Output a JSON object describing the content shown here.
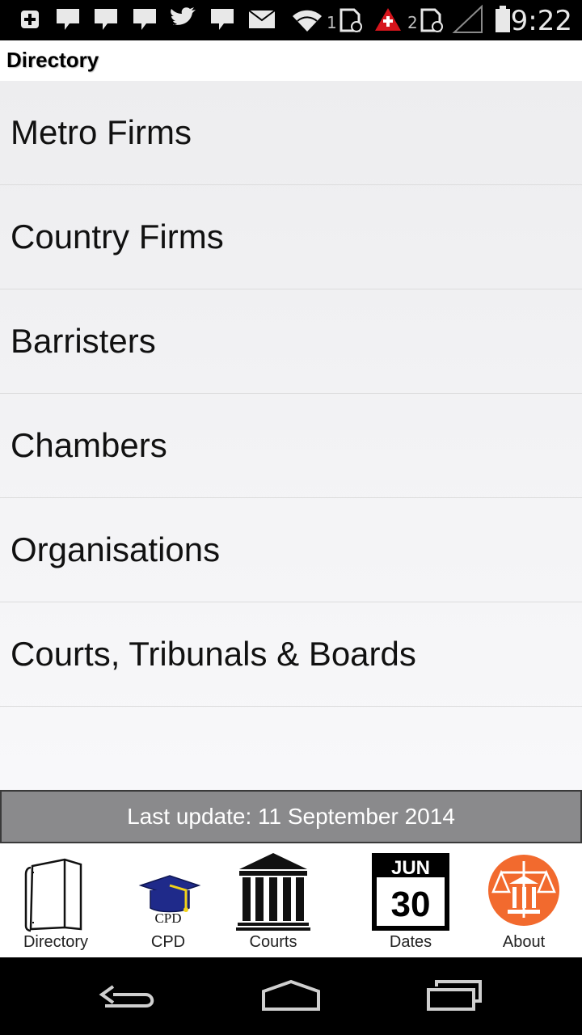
{
  "status_bar": {
    "time": "9:22",
    "sim1_label": "1",
    "sim2_label": "2",
    "icons": [
      "add-icon",
      "chat-icon",
      "chat-icon",
      "chat-icon",
      "twitter-icon",
      "chat-icon",
      "mail-icon",
      "wifi-icon",
      "sim-icon",
      "alert-icon",
      "sim-icon",
      "signal-icon",
      "battery-icon"
    ]
  },
  "header": {
    "title": "Directory"
  },
  "menu": {
    "items": [
      {
        "label": "Metro Firms"
      },
      {
        "label": "Country Firms"
      },
      {
        "label": "Barristers"
      },
      {
        "label": "Chambers"
      },
      {
        "label": "Organisations"
      },
      {
        "label": "Courts, Tribunals & Boards"
      }
    ]
  },
  "update": {
    "text": "Last update: 11 September 2014"
  },
  "tabs": {
    "directory": {
      "label": "Directory",
      "icon": "book-icon"
    },
    "cpd": {
      "label": "CPD",
      "icon": "graduation-cap-icon",
      "icon_text": "CPD"
    },
    "courts": {
      "label": "Courts",
      "icon": "courthouse-icon"
    },
    "dates": {
      "label": "Dates",
      "icon": "calendar-icon",
      "month": "JUN",
      "day": "30"
    },
    "about": {
      "label": "About",
      "icon": "scales-icon"
    }
  },
  "colors": {
    "about_accent": "#f26a2e",
    "cap_blue": "#1f2a8a",
    "tassel_yellow": "#f2d21a"
  }
}
